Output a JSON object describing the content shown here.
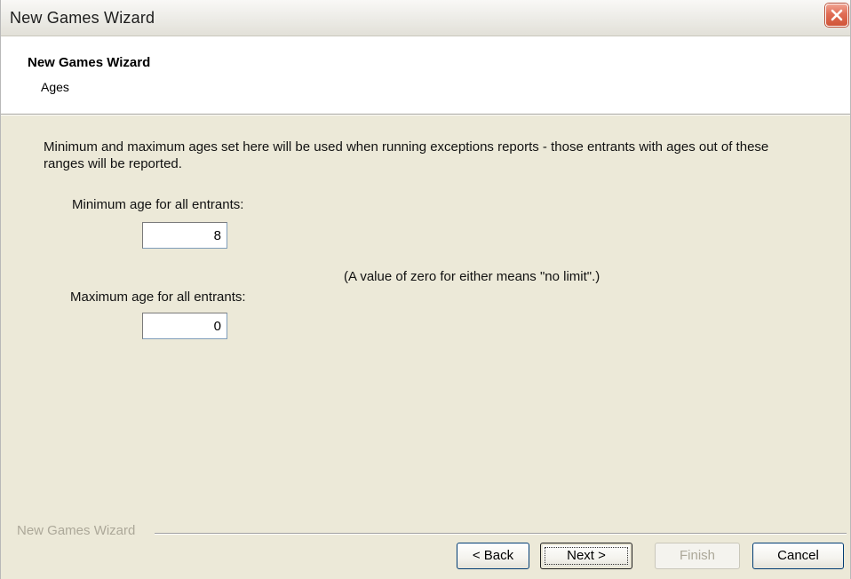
{
  "window": {
    "title": "New Games Wizard"
  },
  "header": {
    "title": "New Games Wizard",
    "subtitle": "Ages"
  },
  "body": {
    "description": "Minimum and maximum ages set here will be used when running exceptions reports - those entrants with ages out of these ranges will be reported.",
    "min_age": {
      "label": "Minimum age for all entrants:",
      "value": "8"
    },
    "max_age": {
      "label": "Maximum age for all entrants:",
      "value": "0"
    },
    "note": "(A value of zero for either means \"no limit\".)"
  },
  "footer": {
    "group_label": "New Games Wizard",
    "back_label": "< Back",
    "next_label": "Next >",
    "finish_label": "Finish",
    "cancel_label": "Cancel"
  },
  "icons": {
    "close": "close-icon"
  },
  "colors": {
    "close_button": "#e06d55",
    "dialog_face": "#ece9d8",
    "disabled_text": "#aca899"
  }
}
